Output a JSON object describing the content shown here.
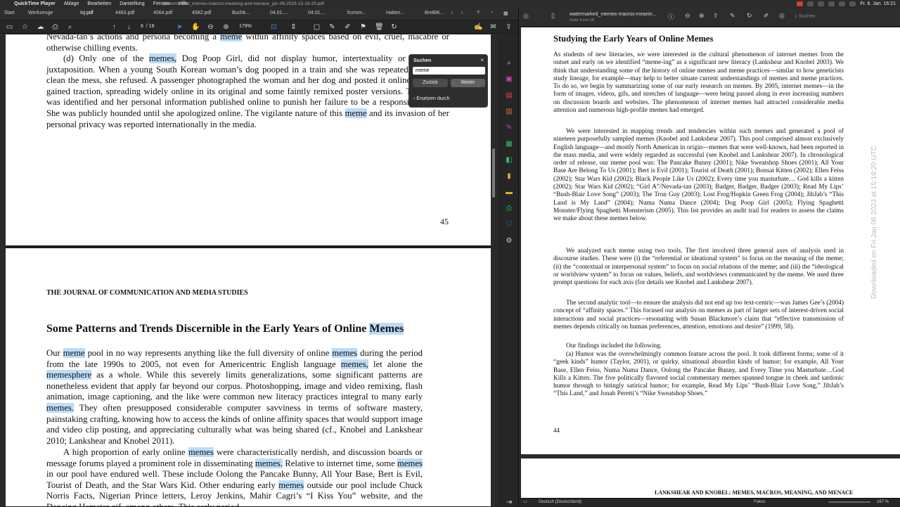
{
  "menubar": {
    "app": "QuickTime Player",
    "items": [
      "Ablage",
      "Bearbeiten",
      "Darstellung",
      "Fenster",
      "Hilfe"
    ],
    "clock": "Fr. 6. Jan. 16:21"
  },
  "left_app": {
    "window_title": "watermarked_memes-macros-meaning-and-menace_jan-06-2023-15-18-20.pdf",
    "nav": {
      "start": "Start",
      "tools": "Werkzeuge"
    },
    "tabs": [
      "Isj.pdf",
      "4463.pdf",
      "4564.pdf",
      "4582.pdf",
      "Buchk...",
      "04.01....",
      "04.01....",
      "fcomm...",
      "Halten...",
      "BreBiK..."
    ],
    "page_current": "6",
    "page_total": "/ 18",
    "zoom": "179%",
    "search": {
      "title": "Suchen",
      "value": "meme",
      "prev": "Zurück",
      "next": "Weiter",
      "advanced": "Ersetzen durch"
    },
    "page_top": {
      "lines_1": "Nevada-tan’s actions and persona becoming a",
      "hl_1": "meme",
      "lines_1b": "within affinity spaces based on evil, cruel, macabre or otherwise chilling events.",
      "para_d_1": "(d) Only one of the",
      "hl_2": "memes,",
      "para_d_2": "Dog Poop Girl, did not display humor, intertextuality or anomalous juxtaposition. When a young South Korean woman’s dog pooped in a train and she was repeatedly asked to clean the mess, she refused. A passenger photographed the woman and her dog and posted it online. It rapidly gained traction, spreading widely online in its original and some faintly remixed poster versions. The woman was identified and her personal information published online to punish her failure to be a responsible citizen. She was publicly hounded until she apologized online. The vigilante nature of this",
      "hl_3": "meme",
      "para_d_3": "and its invasion of her personal privacy was reported internationally in the media.",
      "page_no": "45"
    },
    "page_bottom": {
      "journal": "THE JOURNAL OF COMMUNICATION AND MEDIA STUDIES",
      "heading": "Some Patterns and Trends Discernible in the Early Years of Online",
      "heading_hl": "Memes",
      "p1_a": "Our",
      "p1_hl1": "meme",
      "p1_b": "pool in no way represents anything like the full diversity of online",
      "p1_hl2": "memes",
      "p1_c": "during the period from the late 1990s to 2005, not even for Americentric English language",
      "p1_hl3": "memes,",
      "p1_d": "let alone the",
      "p1_hl4": "memesphere",
      "p1_e": "as a whole. While this severely limits generalizations, some significant patterns are nonetheless evident that apply far beyond our corpus. Photoshopping, image and video remixing, flash animation, image captioning, and the like were common new literacy practices integral to many early",
      "p1_hl5": "memes.",
      "p1_f": "They often presupposed considerable computer savviness in terms of software mastery, painstaking crafting, knowing how to access the kinds of online affinity spaces that would support image and video clip posting, and appreciating culturally what was being shared (cf., Knobel and Lankshear 2010; Lankshear and Knobel 2011).",
      "p2_a": "A high proportion of early online",
      "p2_hl1": "memes",
      "p2_b": "were characteristically nerdish, and discussion boards or message forums played a prominent role in disseminating",
      "p2_hl2": "memes.",
      "p2_c": "Relative to internet time, some",
      "p2_hl3": "memes",
      "p2_d": "in our pool have endured well. These include Oolong the Pancake Bunny, All Your Base, Bert is Evil, Tourist of Death, and the Star Wars Kid. Other enduring early",
      "p2_hl4": "memes",
      "p2_e": "outside our pool include Chuck Norris Facts, Nigerian Prince letters, Leroy Jenkins, Mahir Cagri’s “I Kiss You” website, and the Dancing Hamster gif, among others. This early period"
    }
  },
  "right_app": {
    "title": "watermarked_memes-macros-meanin...",
    "subtitle": "Seite 4 von 18",
    "search_placeholder": "Suchen",
    "heading": "Studying the Early Years of Online Memes",
    "p1": "As students of new literacies, we were interested in the cultural phenomenon of internet memes from the outset and early on we identified “meme-ing” as a significant new literacy (Lankshear and Knobel 2003). We think that understanding some of the history of online memes and meme practices—similar to how geneticists study lineage, for example—may help to better situate current understandings of memes and meme practices. To do so, we begin by summarizing some of our early research on memes. By 2005, internet memes—in the form of images, videos, gifs, and stretches of language—were being passed along in ever increasing numbers on discussion boards and websites. The phenomenon of internet memes had attracted considerable media attention and numerous high-profile memes had emerged.",
    "p2": "We were interested in mapping trends and tendencies within such memes and generated a pool of nineteen purposefully sampled memes (Knobel and Lankshear 2007). This pool comprised almost exclusively English language—and mostly North American in origin—memes that were well-known, had been reported in the mass media, and were widely regarded as successful (see Knobel and Lankshear 2007). In chronological order of release, our meme pool was: The Pancake Bunny (2001); Nike Sweatshop Shoes (2001); All Your Base Are Belong To Us (2001); Bert is Evil (2001); Tourist of Death (2001); Bonsai Kitten (2002); Ellen Feiss (2002); Star Wars Kid (2002); Black People Like Us (2002); Every time you masturbate… God kills a kitten (2002); Star Wars Kid (2002); “Girl A”/Nevada-tan (2003); Badger, Badger, Badger (2003); Read My Lips’ “Bush-Blair Love Song” (2003); The Tron Guy (2003); Lost Frog/Hopkin Green Frog (2004); JibJab’s “This Land is My Land” (2004); Numa Numa Dance (2004); Dog Poop Girl (2005); Flying Spaghetti Monster/Flying Spaghetti Monsterism (2005). This list provides an audit trail for readers to assess the claims we make about these memes below.",
    "p3": "We analyzed each meme using two tools. The first involved three general axes of analysis used in discourse studies. These were (i) the “referential or ideational system” to focus on the meaning of the meme; (ii) the “contextual or interpersonal system” to focus on social relations of the meme; and (iii) the “ideological or worldview system” to focus on values, beliefs, and worldviews communicated by the meme. We used three prompt questions for each axis (for details see Knobel and Lankshear 2007).",
    "p4": "The second analytic tool—to ensure the analysis did not end up too text-centric—was James Gee’s (2004) concept of “affinity spaces.” This focused our analysis on memes as part of larger sets of interest-driven social interactions and social practices—resonating with Susan Blackmore’s claim that “effective transmission of memes depends critically on human preferences, attention, emotions and desire” (1999, 58).",
    "p5": "Our findings included the following.",
    "p6": "(a) Humor was the overwhelmingly common feature across the pool. It took different forms; some of it “geek kinds” humor (Taylor, 2001), or quirky, situational absurdist kinds of humor; for example, All Your Base, Ellen Feiss, Numa Numa Dance, Oolong the Pancake Bunny, and Every Time you Masturbate…God Kills a Kitten. The five politically flavored social commentary memes spanned tongue in cheek and sardonic humor through to bitingly satirical humor; for example, Read My Lips’ “Bush-Blair Love Song,” JibJab’s “This Land,” and Jonah Peretti’s “Nike Sweatshop Shoes.”",
    "page_no": "44",
    "next_page_header": "LANKSHEAR AND KNOBEL: MEMES, MACROS, MEANING, AND MENACE",
    "status_lang": "Deutsch (Deutschland)",
    "status_focus": "Fokus",
    "status_zoom": "167 %",
    "watermark": "Downloaded on Fri Jan 06 2023 at 15:18:20 UTC"
  },
  "colors": {
    "highlight": "#bcdcf7",
    "accent_blue": "#3b8ae6"
  }
}
